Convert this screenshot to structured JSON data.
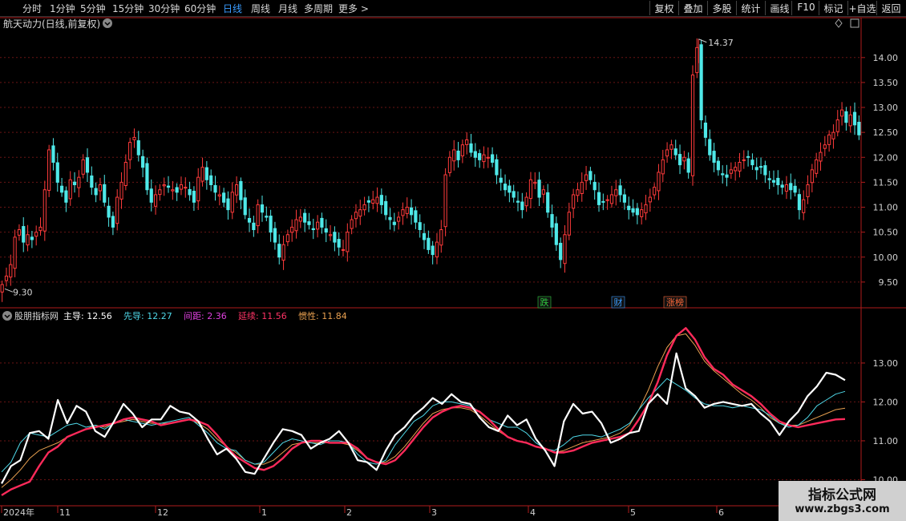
{
  "toolbar": {
    "periods": [
      {
        "label": "分时",
        "active": false
      },
      {
        "label": "1分钟",
        "active": false
      },
      {
        "label": "5分钟",
        "active": false
      },
      {
        "label": "15分钟",
        "active": false
      },
      {
        "label": "30分钟",
        "active": false
      },
      {
        "label": "60分钟",
        "active": false
      },
      {
        "label": "日线",
        "active": true
      },
      {
        "label": "周线",
        "active": false
      },
      {
        "label": "月线",
        "active": false
      },
      {
        "label": "多周期",
        "active": false
      },
      {
        "label": "更多 >",
        "active": false
      }
    ],
    "buttons": [
      "复权",
      "叠加",
      "多股",
      "统计",
      "画线",
      "F10",
      "标记",
      "+自选",
      "返回"
    ]
  },
  "main_panel": {
    "title": "航天动力(日线,前复权)",
    "high_label": "14.37",
    "low_label": "9.30",
    "markers": [
      {
        "label": "跌",
        "color": "#2ecc40",
        "date": "2024-04-02"
      },
      {
        "label": "财",
        "color": "#3a9cff",
        "date": "2024-04-29"
      },
      {
        "label": "涨榜",
        "color": "#ff6a3a",
        "date": "2024-05-20"
      }
    ]
  },
  "indicator_panel": {
    "name": "股朋指标网",
    "fields": [
      {
        "label": "主导: ",
        "value": "12.56",
        "color": "#ffffff"
      },
      {
        "label": "先导: ",
        "value": "12.27",
        "color": "#4fd8e8"
      },
      {
        "label": "间距: ",
        "value": "2.36",
        "color": "#e040e0"
      },
      {
        "label": "延续: ",
        "value": "11.56",
        "color": "#ff3366"
      },
      {
        "label": "惯性: ",
        "value": "11.84",
        "color": "#e8a050"
      }
    ]
  },
  "x_axis_labels": [
    "2024年",
    "11",
    "12",
    "1",
    "2",
    "3",
    "4",
    "5",
    "6"
  ],
  "watermark": {
    "title": "指标公式网",
    "url": "www.zbgs3.com"
  },
  "colors": {
    "up": "#ff3b3b",
    "down": "#4fe8e8",
    "grid": "#6a1414",
    "axis": "#b01c1c"
  },
  "chart_data": [
    {
      "type": "candlestick",
      "title": "航天动力(日线,前复权)",
      "y_ticks": [
        9.5,
        10.0,
        10.5,
        11.0,
        11.5,
        12.0,
        12.5,
        13.0,
        13.5,
        14.0
      ],
      "ylim": [
        9.0,
        14.8
      ],
      "high": 14.37,
      "low": 9.3,
      "closes": [
        9.45,
        9.62,
        9.85,
        10.4,
        10.55,
        10.3,
        10.45,
        10.35,
        10.5,
        10.6,
        11.35,
        12.15,
        11.9,
        11.5,
        11.3,
        11.1,
        11.55,
        11.45,
        11.6,
        11.95,
        11.7,
        11.4,
        11.25,
        11.45,
        11.1,
        10.8,
        10.6,
        11.2,
        11.5,
        11.9,
        12.3,
        12.4,
        12.05,
        11.8,
        11.35,
        11.1,
        11.25,
        11.35,
        11.45,
        11.4,
        11.35,
        11.3,
        11.45,
        11.4,
        11.25,
        11.1,
        11.6,
        11.8,
        11.55,
        11.45,
        11.3,
        11.25,
        11.1,
        10.95,
        11.3,
        11.45,
        11.15,
        10.85,
        10.7,
        10.55,
        11.05,
        10.9,
        10.8,
        10.5,
        10.3,
        10.0,
        10.25,
        10.45,
        10.6,
        10.75,
        10.8,
        10.7,
        10.65,
        10.55,
        10.7,
        10.6,
        10.5,
        10.45,
        10.3,
        10.2,
        10.15,
        10.5,
        10.75,
        10.9,
        10.95,
        11.05,
        11.1,
        11.15,
        11.2,
        11.05,
        10.85,
        10.75,
        10.65,
        10.8,
        10.95,
        11.0,
        10.85,
        10.7,
        10.55,
        10.35,
        10.15,
        10.05,
        10.3,
        10.55,
        11.65,
        12.0,
        12.15,
        11.95,
        12.25,
        12.35,
        12.1,
        12.0,
        11.95,
        12.05,
        12.0,
        11.9,
        11.65,
        11.5,
        11.35,
        11.3,
        11.2,
        11.1,
        10.95,
        11.2,
        11.55,
        11.5,
        11.2,
        11.35,
        10.9,
        10.6,
        10.25,
        9.95,
        10.45,
        10.9,
        11.25,
        11.35,
        11.5,
        11.65,
        11.55,
        11.35,
        11.05,
        11.1,
        11.15,
        11.25,
        11.35,
        11.25,
        11.1,
        10.95,
        10.9,
        10.85,
        10.95,
        11.05,
        11.2,
        11.4,
        11.7,
        11.95,
        12.15,
        12.25,
        12.05,
        11.85,
        12.0,
        11.7,
        13.65,
        14.2,
        12.75,
        12.4,
        12.05,
        11.9,
        11.75,
        11.65,
        11.6,
        11.75,
        11.8,
        11.9,
        11.95,
        12.0,
        11.85,
        11.75,
        11.8,
        11.65,
        11.55,
        11.5,
        11.45,
        11.4,
        11.45,
        11.35,
        11.3,
        10.95,
        11.15,
        11.45,
        11.75,
        11.95,
        12.1,
        12.25,
        12.45,
        12.5,
        12.75,
        12.95,
        12.7,
        12.85,
        12.65,
        12.45
      ]
    },
    {
      "type": "line",
      "title": "股朋指标网",
      "y_ticks": [
        10.0,
        11.0,
        12.0,
        13.0
      ],
      "ylim": [
        9.35,
        14.4
      ],
      "series": [
        {
          "name": "主导",
          "values": [
            9.9,
            10.35,
            10.5,
            11.2,
            11.25,
            11.05,
            12.05,
            11.45,
            11.9,
            11.75,
            11.25,
            11.1,
            11.5,
            11.95,
            11.7,
            11.35,
            11.55,
            11.55,
            11.9,
            11.75,
            11.7,
            11.5,
            11.05,
            10.65,
            10.8,
            10.55,
            10.2,
            10.15,
            10.55,
            10.95,
            11.3,
            11.25,
            11.15,
            10.8,
            10.95,
            11.05,
            11.25,
            10.95,
            10.5,
            10.45,
            10.25,
            10.75,
            11.15,
            11.35,
            11.65,
            11.85,
            12.1,
            11.95,
            12.2,
            12.0,
            11.95,
            11.6,
            11.35,
            11.25,
            11.65,
            11.4,
            11.55,
            11.05,
            10.75,
            10.35,
            11.5,
            11.95,
            11.7,
            11.75,
            11.45,
            10.95,
            11.05,
            11.2,
            11.25,
            11.95,
            12.2,
            11.95,
            13.25,
            12.35,
            12.15,
            11.85,
            11.95,
            12.0,
            11.95,
            11.9,
            11.95,
            11.7,
            11.5,
            11.15,
            11.5,
            11.75,
            12.15,
            12.4,
            12.75,
            12.7,
            12.56
          ]
        },
        {
          "name": "先导",
          "values": [
            10.2,
            10.45,
            10.95,
            11.2,
            11.15,
            11.1,
            11.25,
            11.4,
            11.45,
            11.35,
            11.4,
            11.3,
            11.45,
            11.55,
            11.5,
            11.45,
            11.4,
            11.45,
            11.5,
            11.55,
            11.6,
            11.4,
            11.2,
            10.95,
            10.8,
            10.75,
            10.5,
            10.4,
            10.45,
            10.7,
            10.95,
            11.05,
            11.0,
            10.95,
            10.9,
            11.0,
            11.0,
            10.95,
            10.65,
            10.45,
            10.4,
            10.5,
            10.9,
            11.2,
            11.5,
            11.65,
            11.9,
            12.0,
            12.0,
            11.95,
            11.9,
            11.75,
            11.55,
            11.45,
            11.35,
            11.35,
            11.2,
            10.95,
            10.8,
            10.75,
            10.9,
            11.1,
            11.15,
            11.15,
            11.1,
            11.2,
            11.3,
            11.45,
            11.8,
            12.1,
            12.35,
            12.6,
            12.45,
            12.3,
            12.1,
            11.95,
            11.9,
            11.9,
            11.85,
            11.9,
            11.85,
            11.8,
            11.65,
            11.45,
            11.35,
            11.4,
            11.6,
            11.9,
            12.05,
            12.2,
            12.27
          ]
        },
        {
          "name": "延续",
          "values": [
            9.6,
            9.75,
            9.85,
            9.95,
            10.35,
            10.7,
            10.85,
            11.1,
            11.2,
            11.3,
            11.35,
            11.4,
            11.45,
            11.55,
            11.6,
            11.55,
            11.5,
            11.4,
            11.45,
            11.5,
            11.55,
            11.5,
            11.4,
            11.15,
            10.85,
            10.6,
            10.45,
            10.3,
            10.25,
            10.35,
            10.55,
            10.8,
            10.95,
            11.0,
            11.0,
            10.95,
            10.95,
            10.95,
            10.8,
            10.55,
            10.45,
            10.4,
            10.5,
            10.75,
            11.05,
            11.35,
            11.6,
            11.75,
            11.85,
            11.9,
            11.85,
            11.75,
            11.55,
            11.3,
            11.1,
            11.0,
            10.95,
            10.85,
            10.8,
            10.7,
            10.7,
            10.75,
            10.85,
            10.95,
            11.0,
            11.05,
            11.1,
            11.2,
            11.55,
            11.95,
            12.5,
            13.2,
            13.7,
            13.9,
            13.6,
            13.15,
            12.85,
            12.7,
            12.45,
            12.3,
            12.15,
            11.95,
            11.7,
            11.5,
            11.4,
            11.35,
            11.4,
            11.45,
            11.5,
            11.55,
            11.56
          ]
        },
        {
          "name": "惯性",
          "values": [
            9.8,
            10.0,
            10.25,
            10.55,
            10.75,
            10.85,
            10.95,
            11.1,
            11.2,
            11.3,
            11.4,
            11.35,
            11.45,
            11.5,
            11.55,
            11.5,
            11.45,
            11.45,
            11.45,
            11.5,
            11.55,
            11.45,
            11.3,
            11.05,
            10.85,
            10.7,
            10.5,
            10.4,
            10.4,
            10.5,
            10.7,
            10.9,
            10.95,
            10.95,
            10.95,
            10.95,
            10.95,
            10.9,
            10.75,
            10.55,
            10.45,
            10.45,
            10.6,
            10.85,
            11.15,
            11.45,
            11.7,
            11.8,
            11.85,
            11.85,
            11.8,
            11.65,
            11.45,
            11.25,
            11.1,
            11.0,
            10.95,
            10.85,
            10.8,
            10.7,
            10.75,
            10.85,
            10.95,
            11.0,
            11.05,
            11.1,
            11.2,
            11.4,
            11.8,
            12.3,
            12.9,
            13.4,
            13.7,
            13.75,
            13.45,
            13.05,
            12.8,
            12.6,
            12.4,
            12.2,
            12.05,
            11.85,
            11.6,
            11.45,
            11.4,
            11.4,
            11.5,
            11.6,
            11.7,
            11.8,
            11.84
          ]
        }
      ]
    }
  ]
}
